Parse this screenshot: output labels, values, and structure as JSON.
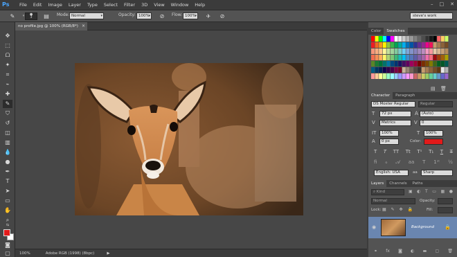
{
  "app": {
    "logo": "Ps"
  },
  "menu": [
    "File",
    "Edit",
    "Image",
    "Layer",
    "Type",
    "Select",
    "Filter",
    "3D",
    "View",
    "Window",
    "Help"
  ],
  "window_controls": {
    "minimize": "–",
    "maximize": "□",
    "close": "✕"
  },
  "options_bar": {
    "brush_size": "3",
    "mode_label": "Mode:",
    "mode_value": "Normal",
    "opacity_label": "Opacity:",
    "opacity_value": "100%",
    "flow_label": "Flow:",
    "flow_value": "100%",
    "workspace": "steve's work"
  },
  "document": {
    "tab_title": "no profile.jpg @ 100% (RGB/8*)",
    "close": "×"
  },
  "status": {
    "zoom": "100%",
    "profile": "Adobe RGB (1998) (8bpc)",
    "arrow": "▶"
  },
  "swatches_panel": {
    "tabs": [
      "Color",
      "Swatches"
    ]
  },
  "character_panel": {
    "tabs": [
      "Character",
      "Paragraph"
    ],
    "font_family": "DS Moster Regular",
    "font_style": "Regular",
    "size": "72 px",
    "leading": "(Auto)",
    "kerning": "Metrics",
    "tracking": "0",
    "vscale": "100%",
    "hscale": "100%",
    "baseline": "0 px",
    "color_label": "Color:",
    "color_value": "#e21a1a",
    "language": "English: USA",
    "aa_prefix": "aa",
    "antialias": "Sharp",
    "style_buttons": [
      "T",
      "T",
      "TT",
      "Tt",
      "T¹",
      "T₁",
      "T",
      "T"
    ]
  },
  "layers_panel": {
    "tabs": [
      "Layers",
      "Channels",
      "Paths"
    ],
    "kind": "Kind",
    "blend": "Normal",
    "opacity_label": "Opacity:",
    "lock_label": "Lock:",
    "fill_label": "Fill:",
    "layer_name": "Background",
    "footer_icons": [
      "link-icon",
      "fx-icon",
      "mask-icon",
      "adjustment-icon",
      "folder-icon",
      "new-layer-icon",
      "trash-icon"
    ]
  }
}
